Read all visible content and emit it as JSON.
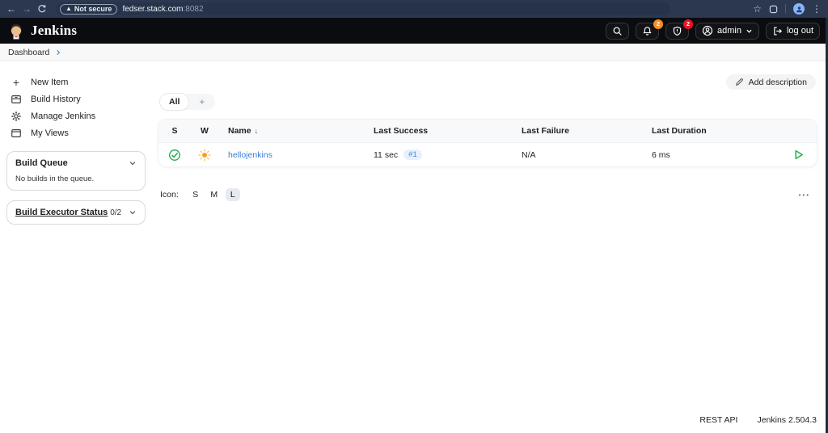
{
  "browser": {
    "security_label": "Not secure",
    "url_host": "fedser.stack.com",
    "url_port": ":8082"
  },
  "header": {
    "product": "Jenkins",
    "notification_count": "2",
    "security_warning_count": "2",
    "user": "admin",
    "logout_label": "log out"
  },
  "breadcrumb": {
    "item": "Dashboard"
  },
  "sidebar": {
    "items": [
      {
        "label": "New Item"
      },
      {
        "label": "Build History"
      },
      {
        "label": "Manage Jenkins"
      },
      {
        "label": "My Views"
      }
    ],
    "build_queue": {
      "title": "Build Queue",
      "empty_text": "No builds in the queue."
    },
    "executor": {
      "title": "Build Executor Status",
      "count": "0/2"
    }
  },
  "main": {
    "add_description_label": "Add description",
    "tabs": {
      "active": "All",
      "new_view": "+"
    },
    "table": {
      "headers": [
        "S",
        "W",
        "Name",
        "Last Success",
        "Last Failure",
        "Last Duration"
      ],
      "sort_arrow": "↓",
      "row": {
        "status": "success",
        "weather": "sunny",
        "name": "hellojenkins",
        "last_success": "11 sec",
        "build_badge": "#1",
        "last_failure": "N/A",
        "last_duration": "6 ms"
      }
    },
    "icon_legend": {
      "label": "Icon:",
      "sizes": [
        "S",
        "M",
        "L"
      ],
      "active": "L"
    },
    "overflow": "•••"
  },
  "footer": {
    "rest_api": "REST API",
    "version": "Jenkins 2.504.3"
  },
  "colors": {
    "accent_link": "#3b7dd8",
    "success_green": "#1ea64d",
    "weather_orange": "#f9a116",
    "badge_orange": "#f78f2a",
    "badge_red": "#eb1226",
    "header_bg": "#0b0c10",
    "browser_bg": "#2b3850"
  }
}
